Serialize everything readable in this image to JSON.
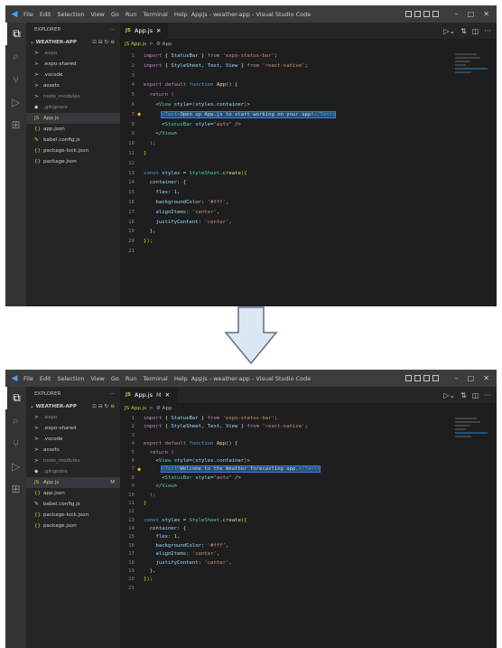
{
  "window": {
    "title": "Appjs - weather-app - Visual Studio Code",
    "menu": [
      "File",
      "Edit",
      "Selection",
      "View",
      "Go",
      "Run",
      "Terminal",
      "Help"
    ],
    "controls": [
      "–",
      "□",
      "✕"
    ]
  },
  "explorer": {
    "header": "EXPLORER",
    "header_more": "···",
    "folder": "WEATHER-APP",
    "items": [
      {
        "icon": ">",
        "label": ".expo",
        "dim": true
      },
      {
        "icon": ">",
        "label": ".expo-shared"
      },
      {
        "icon": ">",
        "label": ".vscode"
      },
      {
        "icon": ">",
        "label": "assets"
      },
      {
        "icon": ">",
        "label": "node_modules",
        "dim": true
      },
      {
        "icon": "◆",
        "label": ".gitignore",
        "dim": true
      },
      {
        "icon": "JS",
        "label": "App.js",
        "selected": true
      },
      {
        "icon": "{}",
        "label": "app.json"
      },
      {
        "icon": "✎",
        "label": "babel.config.js"
      },
      {
        "icon": "{}",
        "label": "package-lock.json"
      },
      {
        "icon": "{}",
        "label": "package.json"
      }
    ],
    "modified_badge": "M"
  },
  "tab": {
    "icon": "JS",
    "label": "App.js",
    "close": "✕",
    "modified": "M"
  },
  "breadcrumb": [
    "JS App.js",
    ">",
    "⚙ App"
  ],
  "top": {
    "jsx_text": "Open up App.js to start working on your app!"
  },
  "bottom": {
    "jsx_text": "Welcome to the Weather forecasting app."
  },
  "code_lines": [
    "1",
    "2",
    "3",
    "4",
    "5",
    "6",
    "7",
    "8",
    "9",
    "10",
    "11",
    "12",
    "13",
    "14",
    "15",
    "16",
    "17",
    "18",
    "19",
    "20",
    "21"
  ],
  "code": {
    "l1": [
      "import ",
      "{ ",
      "StatusBar",
      " } ",
      "from ",
      "'expo-status-bar'",
      ";"
    ],
    "l2": [
      "import ",
      "{ ",
      "StyleSheet, Text, View",
      " } ",
      "from ",
      "'react-native'",
      ";"
    ],
    "l4": [
      "export ",
      "default ",
      "function ",
      "App",
      "() {"
    ],
    "l5": [
      "  return ",
      "("
    ],
    "l6": [
      "    <",
      "View ",
      "style",
      "=",
      "{",
      "styles.container",
      "}",
      ">"
    ],
    "l7_open": "<Text>",
    "l7_close": "</Text>",
    "l8": [
      "      <",
      "StatusBar ",
      "style",
      "=",
      "\"auto\"",
      " />"
    ],
    "l9": [
      "    </",
      "View",
      ">"
    ],
    "l10": "  );",
    "l11": "}",
    "l13": [
      "const ",
      "styles",
      " = ",
      "StyleSheet",
      ".",
      "create",
      "({"
    ],
    "l14": [
      "  container",
      ": {"
    ],
    "l15": [
      "    flex",
      ": ",
      "1",
      ","
    ],
    "l16": [
      "    backgroundColor",
      ": ",
      "'#fff'",
      ","
    ],
    "l17": [
      "    alignItems",
      ": ",
      "'center'",
      ","
    ],
    "l18": [
      "    justifyContent",
      ": ",
      "'center'",
      ","
    ],
    "l19": "  },",
    "l20": "});"
  }
}
